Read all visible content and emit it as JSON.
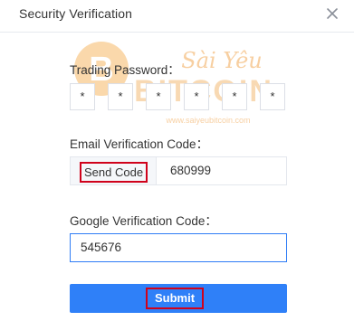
{
  "dialog": {
    "title": "Security Verification",
    "close_icon": "close-icon"
  },
  "trading_password": {
    "label": "Trading Password：",
    "chars": [
      "*",
      "*",
      "*",
      "*",
      "*",
      "*"
    ]
  },
  "email_verification": {
    "label": "Email Verification Code：",
    "send_button_label": "Send Code",
    "value": "680999"
  },
  "google_verification": {
    "label": "Google Verification Code：",
    "value": "545676"
  },
  "submit": {
    "label": "Submit"
  },
  "watermark": {
    "brand_text": "BITCOIN",
    "script_text": "Sài Yêu",
    "url_text": "www.saiyeubitcoin.com"
  },
  "colors": {
    "primary": "#2f80f8",
    "highlight_border": "#d0021b",
    "watermark": "#f0a046"
  }
}
